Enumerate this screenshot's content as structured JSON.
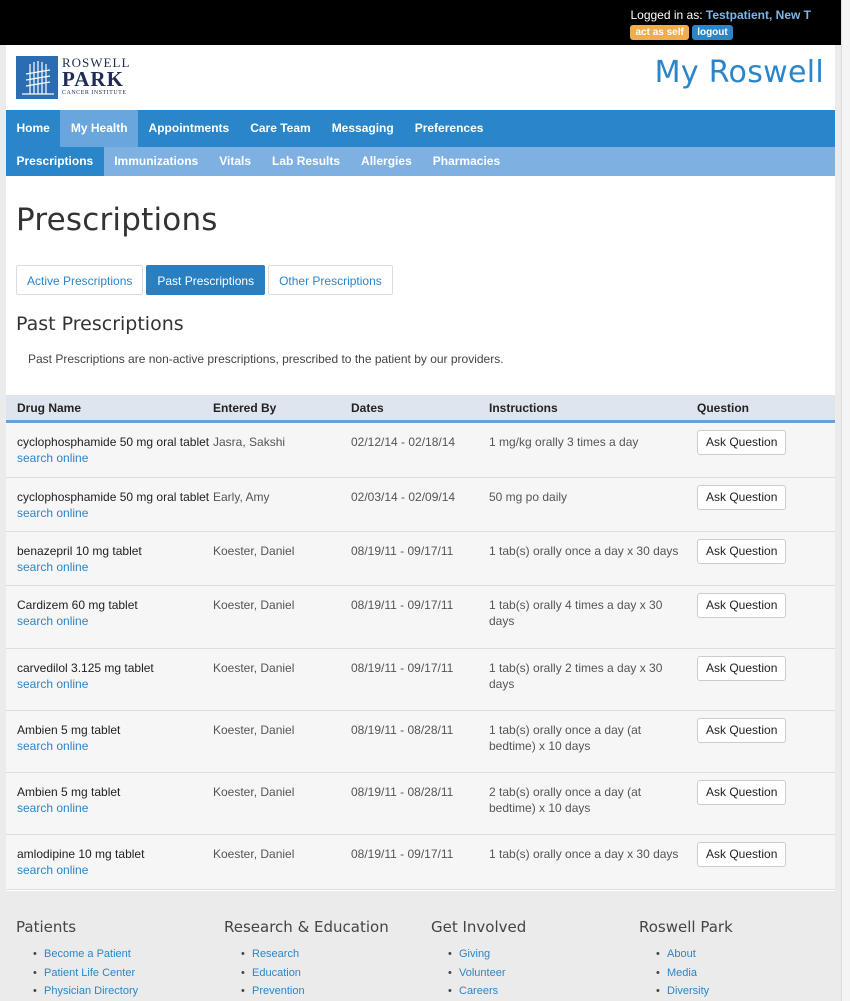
{
  "topbar": {
    "logged_in_label": "Logged in as:",
    "user_name": "Testpatient, New T",
    "act_as_self": "act as self",
    "logout": "logout"
  },
  "logo": {
    "line1": "ROSWELL",
    "line2": "PARK",
    "line3": "CANCER INSTITUTE"
  },
  "brand": "My Roswell",
  "nav": {
    "primary": [
      "Home",
      "My Health",
      "Appointments",
      "Care Team",
      "Messaging",
      "Preferences"
    ],
    "primary_active": "My Health",
    "secondary": [
      "Prescriptions",
      "Immunizations",
      "Vitals",
      "Lab Results",
      "Allergies",
      "Pharmacies"
    ],
    "secondary_active": "Prescriptions"
  },
  "page_title": "Prescriptions",
  "tabs": {
    "active": "Active Prescriptions",
    "past": "Past Prescriptions",
    "other": "Other Prescriptions"
  },
  "section": {
    "title": "Past Prescriptions",
    "description": "Past Prescriptions are non-active prescriptions, prescribed to the patient by our providers."
  },
  "table": {
    "headers": [
      "Drug Name",
      "Entered By",
      "Dates",
      "Instructions",
      "Question"
    ],
    "link_label": "search online",
    "button_label": "Ask Question",
    "rows": [
      {
        "drug": "cyclophosphamide 50 mg oral tablet",
        "entered_by": "Jasra, Sakshi",
        "dates": "02/12/14 - 02/18/14",
        "instructions": "1 mg/kg orally 3 times a day"
      },
      {
        "drug": "cyclophosphamide 50 mg oral tablet",
        "entered_by": "Early, Amy",
        "dates": "02/03/14 - 02/09/14",
        "instructions": "50 mg po daily"
      },
      {
        "drug": "benazepril 10 mg tablet",
        "entered_by": "Koester, Daniel",
        "dates": "08/19/11 - 09/17/11",
        "instructions": "1 tab(s) orally once a day x 30 days"
      },
      {
        "drug": "Cardizem 60 mg tablet",
        "entered_by": "Koester, Daniel",
        "dates": "08/19/11 - 09/17/11",
        "instructions": "1 tab(s) orally 4 times a day x 30 days"
      },
      {
        "drug": "carvedilol 3.125 mg tablet",
        "entered_by": "Koester, Daniel",
        "dates": "08/19/11 - 09/17/11",
        "instructions": "1 tab(s) orally 2 times a day x 30 days"
      },
      {
        "drug": "Ambien 5 mg tablet",
        "entered_by": "Koester, Daniel",
        "dates": "08/19/11 - 08/28/11",
        "instructions": "1 tab(s) orally once a day (at bedtime) x 10 days"
      },
      {
        "drug": "Ambien 5 mg tablet",
        "entered_by": "Koester, Daniel",
        "dates": "08/19/11 - 08/28/11",
        "instructions": "2 tab(s) orally once a day (at bedtime) x 10 days"
      },
      {
        "drug": "amlodipine 10 mg tablet",
        "entered_by": "Koester, Daniel",
        "dates": "08/19/11 - 09/17/11",
        "instructions": "1 tab(s) orally once a day x 30 days"
      }
    ]
  },
  "footer": {
    "patients": {
      "title": "Patients",
      "links": [
        "Become a Patient",
        "Patient Life Center",
        "Physician Directory"
      ]
    },
    "research": {
      "title": "Research & Education",
      "links": [
        "Research",
        "Education",
        "Prevention"
      ]
    },
    "involved": {
      "title": "Get Involved",
      "links": [
        "Giving",
        "Volunteer",
        "Careers"
      ]
    },
    "roswell": {
      "title": "Roswell Park",
      "links": [
        "About",
        "Media",
        "Diversity"
      ]
    }
  },
  "colors": {
    "primary_blue": "#2a86c9",
    "nav_secondary": "#7fb0e2",
    "badge_orange": "#f0ad4e"
  }
}
